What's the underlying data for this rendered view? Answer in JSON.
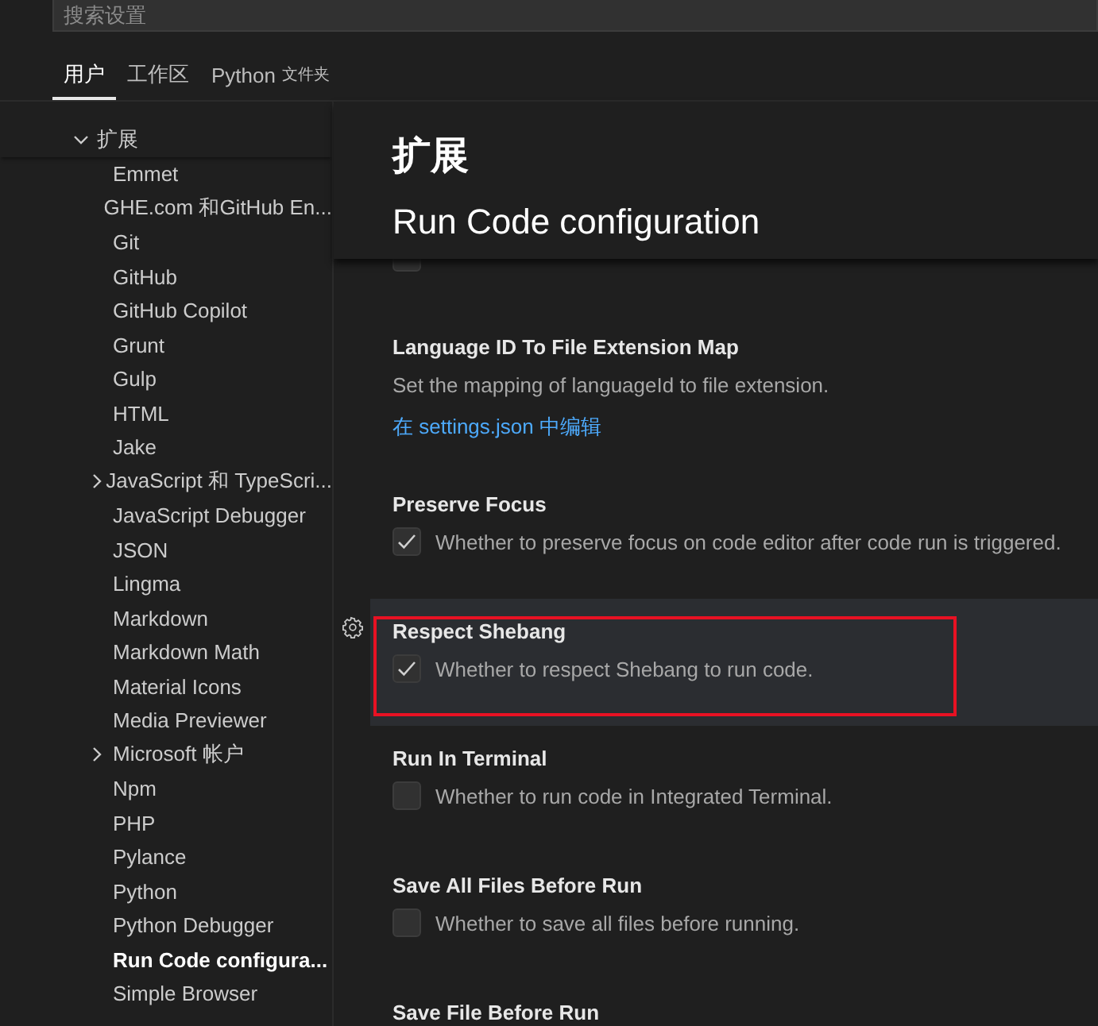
{
  "search": {
    "placeholder": "搜索设置"
  },
  "tabs": [
    {
      "label": "用户",
      "selected": true
    },
    {
      "label": "工作区",
      "selected": false
    },
    {
      "label": "Python",
      "suffix": "文件夹",
      "selected": false
    }
  ],
  "toc": {
    "label": "扩展",
    "expanded": true,
    "children": [
      {
        "label": "Emmet",
        "selected": false
      },
      {
        "label": "GHE.com 和GitHub En...",
        "selected": false
      },
      {
        "label": "Git",
        "selected": false
      },
      {
        "label": "GitHub",
        "selected": false
      },
      {
        "label": "GitHub Copilot",
        "selected": false
      },
      {
        "label": "Grunt",
        "selected": false
      },
      {
        "label": "Gulp",
        "selected": false
      },
      {
        "label": "HTML",
        "selected": false
      },
      {
        "label": "Jake",
        "selected": false
      },
      {
        "label": "JavaScript 和 TypeScri...",
        "selected": false,
        "expanded": false
      },
      {
        "label": "JavaScript Debugger",
        "selected": false
      },
      {
        "label": "JSON",
        "selected": false
      },
      {
        "label": "Lingma",
        "selected": false
      },
      {
        "label": "Markdown",
        "selected": false
      },
      {
        "label": "Markdown Math",
        "selected": false
      },
      {
        "label": "Material Icons",
        "selected": false
      },
      {
        "label": "Media Previewer",
        "selected": false
      },
      {
        "label": "Microsoft 帐户",
        "selected": false,
        "expanded": false
      },
      {
        "label": "Npm",
        "selected": false
      },
      {
        "label": "PHP",
        "selected": false
      },
      {
        "label": "Pylance",
        "selected": false
      },
      {
        "label": "Python",
        "selected": false
      },
      {
        "label": "Python Debugger",
        "selected": false
      },
      {
        "label": "Run Code configura...",
        "selected": true
      },
      {
        "label": "Simple Browser",
        "selected": false
      }
    ]
  },
  "header": {
    "category": "扩展",
    "section": "Run Code configuration"
  },
  "settings": [
    {
      "kind": "checkbox",
      "checked": false,
      "focused": false,
      "highlighted": false
    },
    {
      "kind": "link",
      "title": "Language ID To File Extension Map",
      "description": "Set the mapping of languageId to file extension.",
      "link": "在 settings.json 中编辑",
      "focused": false,
      "highlighted": false
    },
    {
      "kind": "checkbox",
      "title": "Preserve Focus",
      "description": "Whether to preserve focus on code editor after code run is triggered.",
      "checked": true,
      "focused": false,
      "highlighted": false
    },
    {
      "kind": "checkbox",
      "title": "Respect Shebang",
      "description": "Whether to respect Shebang to run code.",
      "checked": true,
      "focused": true,
      "highlighted": true
    },
    {
      "kind": "checkbox",
      "title": "Run In Terminal",
      "description": "Whether to run code in Integrated Terminal.",
      "checked": false,
      "focused": false,
      "highlighted": false
    },
    {
      "kind": "checkbox",
      "title": "Save All Files Before Run",
      "description": "Whether to save all files before running.",
      "checked": false,
      "focused": false,
      "highlighted": false
    },
    {
      "kind": "checkbox",
      "title": "Save File Before Run",
      "focused": false,
      "highlighted": false
    }
  ]
}
